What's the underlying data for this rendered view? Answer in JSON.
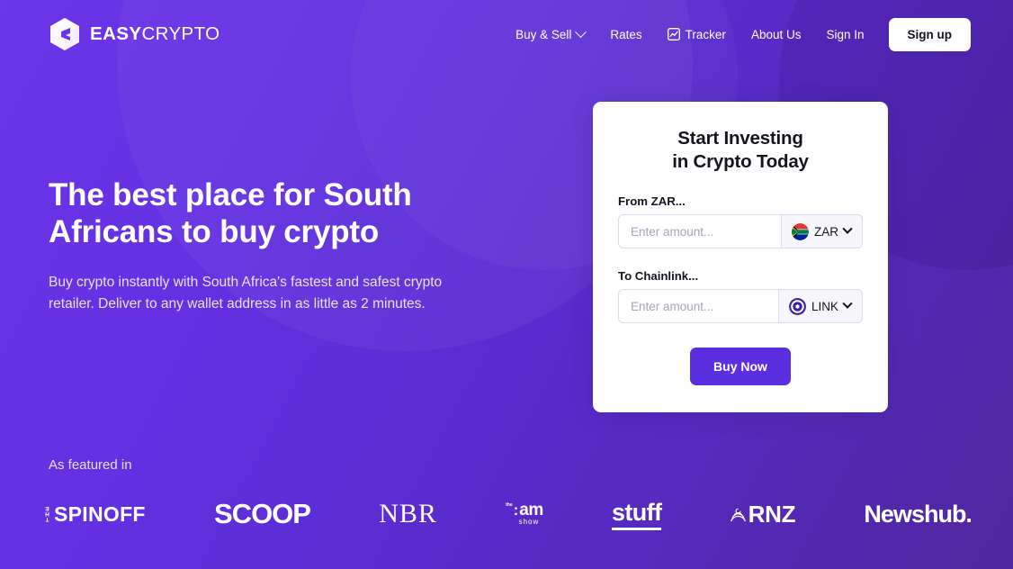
{
  "brand": {
    "name_bold": "EASY",
    "name_light": "CRYPTO",
    "logo_icon": "easycrypto-hexagon-logo"
  },
  "nav": {
    "items": [
      {
        "label": "Buy & Sell",
        "icon": "chevron-down-icon",
        "has_chevron": true
      },
      {
        "label": "Rates",
        "icon": "",
        "has_chevron": false
      },
      {
        "label": "Tracker",
        "icon": "chart-tracker-icon",
        "has_chevron": false
      },
      {
        "label": "About Us",
        "icon": "",
        "has_chevron": false
      },
      {
        "label": "Sign In",
        "icon": "",
        "has_chevron": false
      }
    ],
    "signup_label": "Sign up"
  },
  "hero": {
    "heading": "The best place for South Africans to buy crypto",
    "subheading": "Buy crypto instantly with South Africa's fastest and safest crypto retailer. Deliver to any wallet address in as little as 2 minutes."
  },
  "featured": {
    "label": "As featured in",
    "logos": [
      {
        "id": "the-spinoff",
        "prefix": "THE",
        "text": "SPINOFF"
      },
      {
        "id": "scoop",
        "text": "SCOOP"
      },
      {
        "id": "nbr",
        "text": "NBR"
      },
      {
        "id": "the-am-show",
        "prefix": "the",
        "colon": ":",
        "text": "am",
        "suffix": "show"
      },
      {
        "id": "stuff",
        "text": "stuff"
      },
      {
        "id": "rnz",
        "text": "RNZ"
      },
      {
        "id": "newshub",
        "text": "Newshub."
      }
    ]
  },
  "card": {
    "title_line1": "Start Investing",
    "title_line2": "in Crypto Today",
    "from": {
      "label": "From ZAR...",
      "amount_value": "",
      "amount_placeholder": "Enter amount...",
      "currency_code": "ZAR",
      "currency_icon": "south-africa-flag-icon"
    },
    "to": {
      "label": "To Chainlink...",
      "amount_value": "",
      "amount_placeholder": "Enter amount...",
      "currency_code": "LINK",
      "currency_icon": "chainlink-link-icon"
    },
    "buy_label": "Buy Now"
  },
  "colors": {
    "bg_gradient_start": "#6b35e8",
    "bg_gradient_end": "#50279f",
    "accent_purple": "#5b2ee0",
    "card_bg": "#ffffff",
    "text_dark": "#16141f",
    "placeholder": "#a9a3bd"
  }
}
